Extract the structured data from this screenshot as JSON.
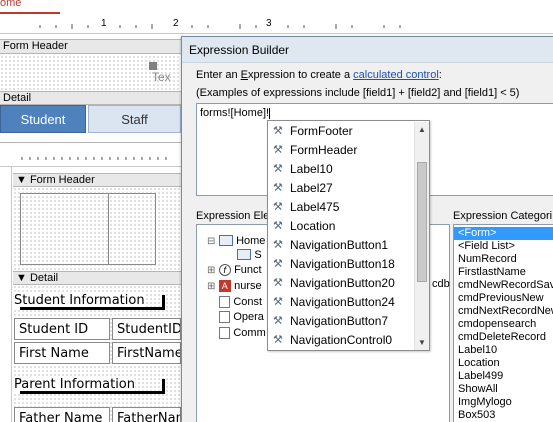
{
  "tab": {
    "label": "ome"
  },
  "ruler_marks": [
    "1",
    "2",
    "3"
  ],
  "form": {
    "form_header_label": "Form Header",
    "detail_label": "Detail",
    "tab_buttons": [
      "Student",
      "Staff"
    ],
    "partial_text": "Tex"
  },
  "subform": {
    "form_header_label": "Form Header",
    "detail_label": "Detail",
    "student_info": "Student Information",
    "student_id_label": "Student ID",
    "student_id_field": "StudentID",
    "first_name_label": "First Name",
    "first_name_field": "FirstName",
    "parent_info": "Parent Information",
    "father_name_label": "Father Name",
    "father_name_field": "FatherName"
  },
  "dialog": {
    "title": "Expression Builder",
    "instruction_prefix": "Enter an ",
    "instruction_expr": "E",
    "instruction_mid": "xpression to create a ",
    "instruction_link": "calculated control",
    "instruction_end": ":",
    "examples": "(Examples of expressions include [field1] + [field2] and [field1] < 5)",
    "expression_value": "forms![Home]!",
    "elements_label": "Expression Elem",
    "categories_label": "Expression Categori",
    "tree": [
      {
        "label": "Home",
        "icon": "form-icon",
        "expander": "⊟"
      },
      {
        "label": "S",
        "icon": "subform-icon",
        "expander": ""
      },
      {
        "label": "Funct",
        "icon": "function-icon",
        "expander": "⊞"
      },
      {
        "label": "nurse",
        "icon": "database-icon",
        "expander": "⊞"
      },
      {
        "label": "Const",
        "icon": "folder-icon",
        "expander": ""
      },
      {
        "label": "Opera",
        "icon": "folder-icon",
        "expander": ""
      },
      {
        "label": "Comm",
        "icon": "folder-icon",
        "expander": ""
      }
    ],
    "tree_suffix": "cdb",
    "categories": [
      "<Form>",
      "<Field List>",
      "NumRecord",
      "FirstlastName",
      "cmdNewRecordSave",
      "cmdPreviousNew",
      "cmdNextRecordNew",
      "cmdopensearch",
      "cmdDeleteRecord",
      "Label10",
      "Location",
      "Label499",
      "ShowAll",
      "ImgMylogo",
      "Box503"
    ],
    "selected_category": 0
  },
  "autocomplete": {
    "items": [
      "FormFooter",
      "FormHeader",
      "Label10",
      "Label27",
      "Label475",
      "Location",
      "NavigationButton1",
      "NavigationButton18",
      "NavigationButton20",
      "NavigationButton24",
      "NavigationButton7",
      "NavigationControl0"
    ],
    "icon": "property-icon"
  },
  "colors": {
    "accent": "#4f81bd",
    "selection": "#3399ff",
    "tab_red": "#c0392b",
    "link": "#1a4fb5"
  }
}
